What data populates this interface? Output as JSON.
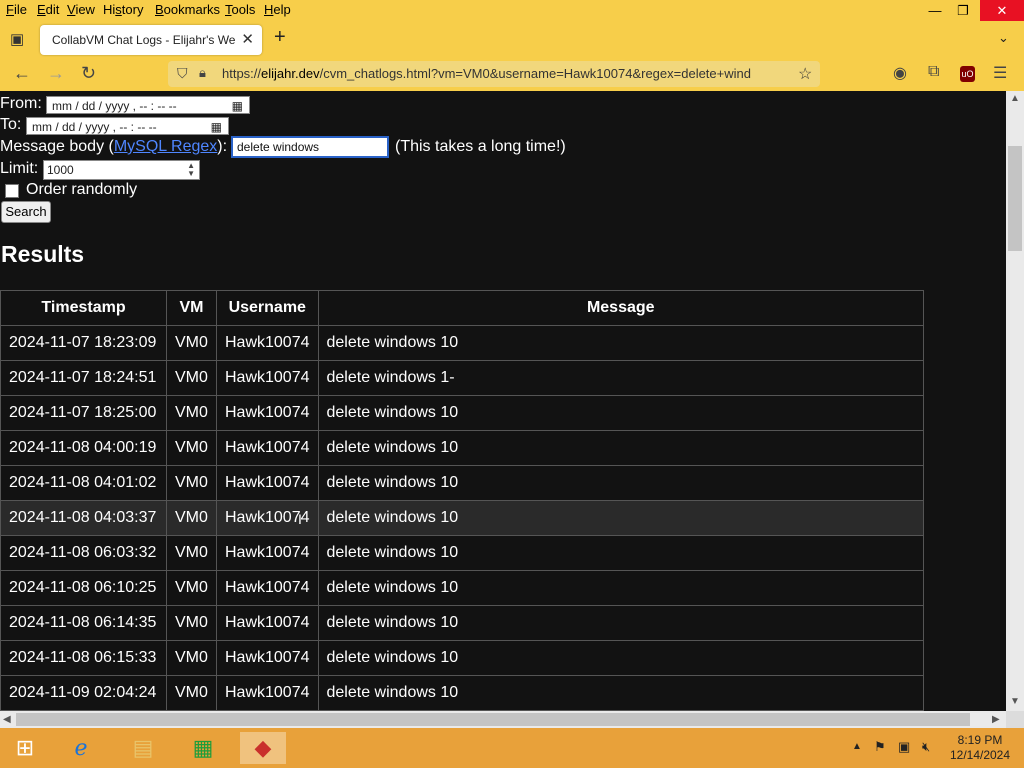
{
  "menu": {
    "items": [
      {
        "pre": "",
        "u": "F",
        "post": "ile"
      },
      {
        "pre": "",
        "u": "E",
        "post": "dit"
      },
      {
        "pre": "",
        "u": "V",
        "post": "iew"
      },
      {
        "pre": "Hi",
        "u": "s",
        "post": "tory"
      },
      {
        "pre": "",
        "u": "B",
        "post": "ookmarks"
      },
      {
        "pre": "",
        "u": "T",
        "post": "ools"
      },
      {
        "pre": "",
        "u": "H",
        "post": "elp"
      }
    ]
  },
  "window": {
    "minimize": "—",
    "restore": "❐",
    "close": "✕"
  },
  "tab": {
    "title": "CollabVM Chat Logs - Elijahr's Web",
    "close": "✕",
    "new_tab": "+"
  },
  "nav": {
    "url_domain": "elijahr.dev",
    "url_prefix": "https://",
    "url_rest": "/cvm_chatlogs.html?vm=VM0&username=Hawk10074&regex=delete+wind"
  },
  "form": {
    "from_label": "From:",
    "to_label": "To:",
    "datetime_placeholder": "mm / dd / yyyy ,  -- : --  --",
    "message_label_pre": "Message body (",
    "message_link": "MySQL Regex",
    "message_label_post": "):",
    "regex_value": "delete windows",
    "regex_note": "(This takes a long time!)",
    "limit_label": "Limit:",
    "limit_value": "1000",
    "order_label": "Order randomly",
    "search_label": "Search"
  },
  "results": {
    "heading": "Results",
    "columns": [
      "Timestamp",
      "VM",
      "Username",
      "Message"
    ],
    "rows": [
      [
        "2024-11-07 18:23:09",
        "VM0",
        "Hawk10074",
        "delete windows 10"
      ],
      [
        "2024-11-07 18:24:51",
        "VM0",
        "Hawk10074",
        "delete windows 1-"
      ],
      [
        "2024-11-07 18:25:00",
        "VM0",
        "Hawk10074",
        "delete windows 10"
      ],
      [
        "2024-11-08 04:00:19",
        "VM0",
        "Hawk10074",
        "delete windows 10"
      ],
      [
        "2024-11-08 04:01:02",
        "VM0",
        "Hawk10074",
        "delete windows 10"
      ],
      [
        "2024-11-08 04:03:37",
        "VM0",
        "Hawk10074",
        "delete windows 10"
      ],
      [
        "2024-11-08 06:03:32",
        "VM0",
        "Hawk10074",
        "delete windows 10"
      ],
      [
        "2024-11-08 06:10:25",
        "VM0",
        "Hawk10074",
        "delete windows 10"
      ],
      [
        "2024-11-08 06:14:35",
        "VM0",
        "Hawk10074",
        "delete windows 10"
      ],
      [
        "2024-11-08 06:15:33",
        "VM0",
        "Hawk10074",
        "delete windows 10"
      ],
      [
        "2024-11-09 02:04:24",
        "VM0",
        "Hawk10074",
        "delete windows 10"
      ]
    ]
  },
  "taskbar": {
    "time": "8:19 PM",
    "date": "12/14/2024"
  },
  "colors": {
    "theme_yellow": "#f7ce4a",
    "page_bg": "#121212",
    "link": "#4f86ff",
    "taskbar": "#e8a13a"
  }
}
